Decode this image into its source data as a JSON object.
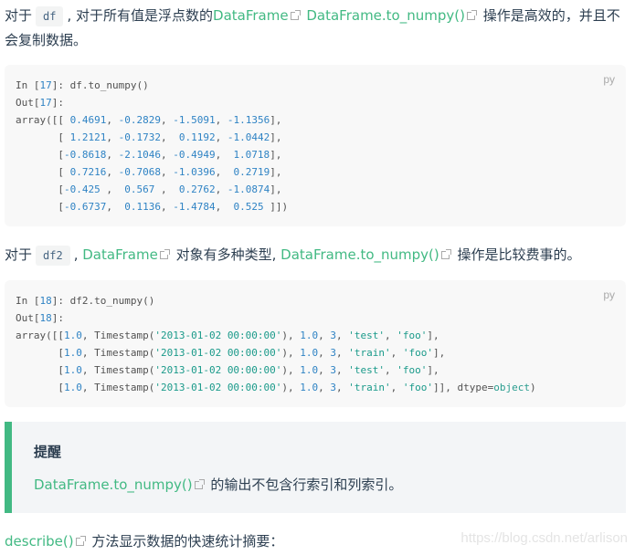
{
  "para1": {
    "prefix": "对于",
    "code": "df",
    "mid": ", 对于所有值是浮点数的",
    "link1": "DataFrame",
    "link2": "DataFrame.to_numpy()",
    "suffix": "操作是高效的，并且不会复制数据。"
  },
  "code1": {
    "lang": "py",
    "in_prefix": "In [",
    "in_num": "17",
    "in_suffix": "]: df.to_numpy()",
    "out_prefix": "Out[",
    "out_num": "17",
    "out_suffix": "]:",
    "array_open": "array([[",
    "rows": [
      [
        "0.4691",
        "-0.2829",
        "-1.5091",
        "-1.1356"
      ],
      [
        "1.2121",
        "-0.1732",
        "0.1192",
        "-1.0442"
      ],
      [
        "-0.8618",
        "-2.1046",
        "-0.4949",
        "1.0718"
      ],
      [
        "0.7216",
        "-0.7068",
        "-1.0396",
        "0.2719"
      ],
      [
        "-0.425",
        "0.567",
        "0.2762",
        "-1.0874"
      ],
      [
        "-0.6737",
        "0.1136",
        "-1.4784",
        "0.525"
      ]
    ]
  },
  "para2": {
    "prefix": "对于",
    "code": "df2",
    "mid": ", ",
    "link1": "DataFrame",
    "mid2": "对象有多种类型, ",
    "link2": "DataFrame.to_numpy()",
    "suffix": "操作是比较费事的。"
  },
  "code2": {
    "lang": "py",
    "in_prefix": "In [",
    "in_num": "18",
    "in_suffix": "]: df2.to_numpy()",
    "out_prefix": "Out[",
    "out_num": "18",
    "out_suffix": "]:",
    "rows": [
      {
        "a": "1.0",
        "ts": "'2013-01-02 00:00:00'",
        "b": "1.0",
        "c": "3",
        "d": "'test'",
        "e": "'foo'"
      },
      {
        "a": "1.0",
        "ts": "'2013-01-02 00:00:00'",
        "b": "1.0",
        "c": "3",
        "d": "'train'",
        "e": "'foo'"
      },
      {
        "a": "1.0",
        "ts": "'2013-01-02 00:00:00'",
        "b": "1.0",
        "c": "3",
        "d": "'test'",
        "e": "'foo'"
      },
      {
        "a": "1.0",
        "ts": "'2013-01-02 00:00:00'",
        "b": "1.0",
        "c": "3",
        "d": "'train'",
        "e": "'foo'"
      }
    ],
    "dtype_label": "dtype=",
    "dtype_value": "object"
  },
  "tip": {
    "title": "提醒",
    "link": "DataFrame.to_numpy()",
    "text": "的输出不包含行索引和列索引。"
  },
  "para3": {
    "link": "describe()",
    "text": "方法显示数据的快速统计摘要："
  },
  "watermark": "https://blog.csdn.net/arlison",
  "colors": {
    "link": "#42b983",
    "text": "#2c3e50",
    "code_bg": "#f8f8f8",
    "tip_bg": "#f3f5f7",
    "tip_border": "#42b983",
    "number": "#2f83c4",
    "string": "#1a9a8a"
  }
}
